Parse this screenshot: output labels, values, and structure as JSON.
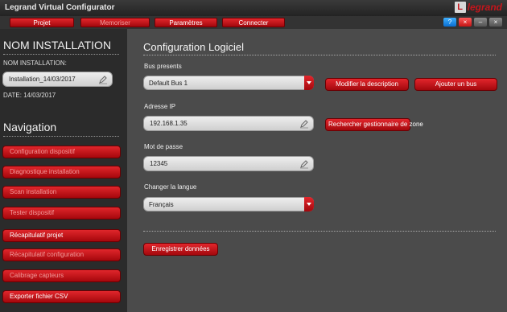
{
  "app": {
    "title": "Legrand Virtual Configurator",
    "brand_box": "L",
    "brand_name": "legrand"
  },
  "menu": {
    "items": [
      {
        "label": "Projet",
        "enabled": true
      },
      {
        "label": "Memoriser",
        "enabled": false
      },
      {
        "label": "Paramètres",
        "enabled": true
      },
      {
        "label": "Connecter",
        "enabled": true
      }
    ]
  },
  "window_controls": [
    "help-icon",
    "close-red-icon",
    "minimize-icon",
    "close-icon"
  ],
  "sidebar": {
    "installation_heading": "NOM INSTALLATION",
    "installation_label": "NOM INSTALLATION:",
    "installation_value": "Installation_14/03/2017",
    "date_text": "DATE: 14/03/2017",
    "navigation_heading": "Navigation",
    "nav_items": [
      {
        "label": "Configuration dispositif",
        "enabled": false
      },
      {
        "label": "Diagnostique installation",
        "enabled": false
      },
      {
        "label": "Scan installation",
        "enabled": false
      },
      {
        "label": "Tester dispositif",
        "enabled": false
      },
      {
        "label": "Récapitulatif projet",
        "enabled": true
      },
      {
        "label": "Récapitulatif configuration",
        "enabled": false
      },
      {
        "label": "Calibrage capteurs",
        "enabled": false
      },
      {
        "label": "Exporter fichier CSV",
        "enabled": true
      }
    ]
  },
  "main": {
    "title": "Configuration Logiciel",
    "bus_label": "Bus presents",
    "bus_value": "Default Bus 1",
    "modify_button": "Modifier la description",
    "add_bus_button": "Ajouter un bus",
    "ip_label": "Adresse IP",
    "ip_value": "192.168.1.35",
    "search_button": "Rechercher gestionnaire de zone",
    "password_label": "Mot de passe",
    "password_value": "12345",
    "language_label": "Changer la langue",
    "language_value": "Français",
    "save_button": "Enregistrer données"
  },
  "colors": {
    "accent_red": "#c4161c",
    "background": "#4b4b4b",
    "sidebar": "#2b2b2b"
  }
}
